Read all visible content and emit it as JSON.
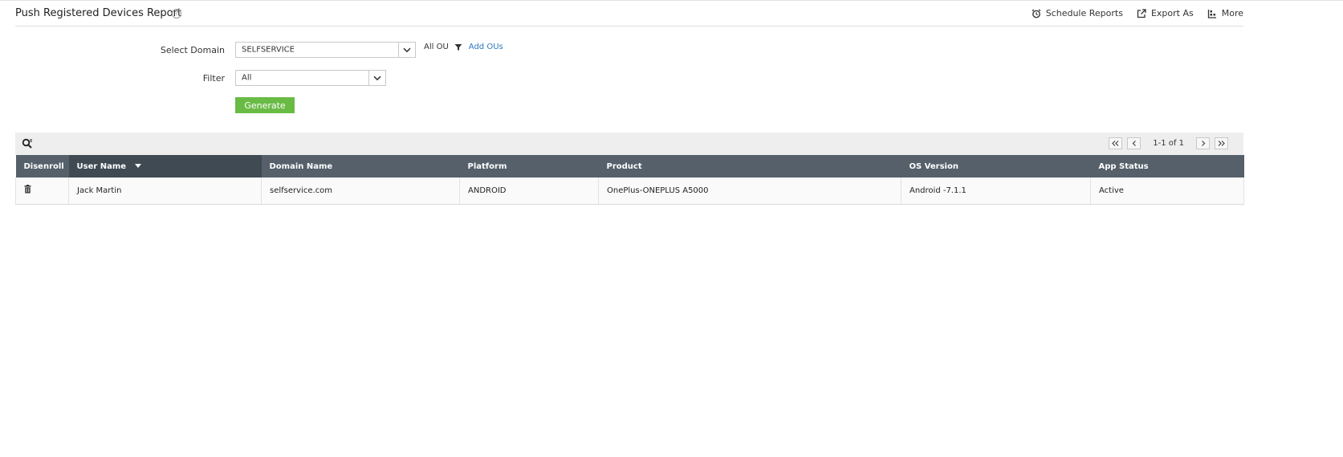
{
  "header": {
    "title": "Push Registered Devices Report",
    "help_glyph": "?",
    "actions": {
      "schedule": "Schedule Reports",
      "export": "Export As",
      "more": "More"
    }
  },
  "form": {
    "domain_label": "Select Domain",
    "domain_value": "SELFSERVICE",
    "ou_text": "All OU",
    "add_ous": "Add OUs",
    "filter_label": "Filter",
    "filter_value": "All",
    "generate": "Generate"
  },
  "pager": {
    "info": "1-1 of 1"
  },
  "table": {
    "columns": [
      "Disenroll",
      "User Name",
      "Domain Name",
      "Platform",
      "Product",
      "OS Version",
      "App Status"
    ],
    "sorted_column": "User Name",
    "rows": [
      {
        "user_name": "Jack Martin",
        "domain_name": "selfservice.com",
        "platform": "ANDROID",
        "product": "OnePlus-ONEPLUS A5000",
        "os_version": "Android -7.1.1",
        "app_status": "Active"
      }
    ]
  },
  "colors": {
    "accent_green": "#6abb45",
    "link_blue": "#2a7ac0",
    "table_header": "#55606a",
    "table_header_sorted": "#3f4a53"
  }
}
